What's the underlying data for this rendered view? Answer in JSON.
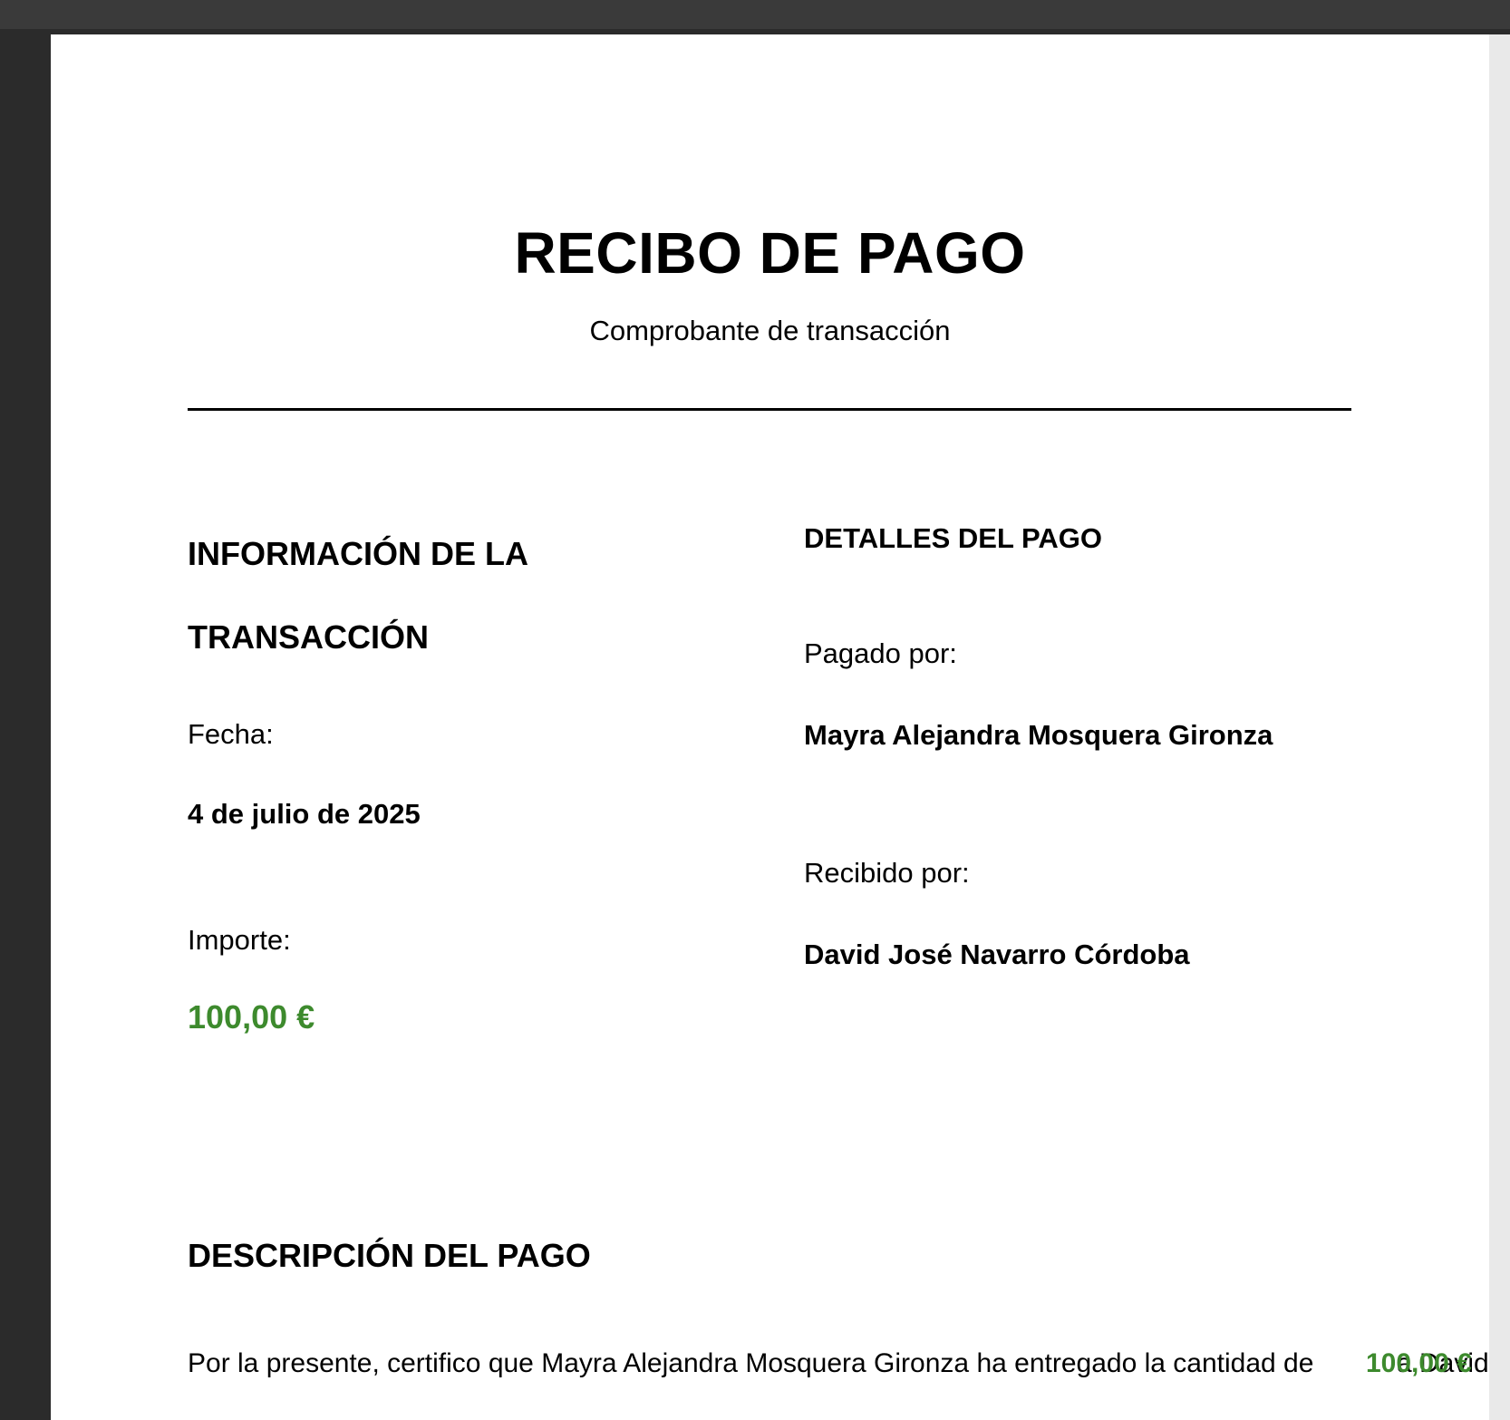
{
  "document": {
    "title": "RECIBO DE PAGO",
    "subtitle": "Comprobante de transacción",
    "transaction_section": {
      "heading": "INFORMACIÓN DE LA TRANSACCIÓN",
      "date_label": "Fecha:",
      "date_value": "4 de julio de 2025",
      "amount_label": "Importe:",
      "amount_value": "100,00 €"
    },
    "payment_details": {
      "heading": "DETALLES DEL PAGO",
      "paid_by_label": "Pagado por:",
      "paid_by_value": "Mayra Alejandra Mosquera Gironza",
      "received_by_label": "Recibido por:",
      "received_by_value": "David José Navarro Córdoba"
    },
    "description": {
      "heading": "DESCRIPCIÓN DEL PAGO",
      "text": "Por la presente, certifico que Mayra Alejandra Mosquera Gironza ha entregado la cantidad de",
      "amount": "100,00 €",
      "tail": "a David"
    },
    "colors": {
      "amount_green": "#3d8a2d"
    }
  }
}
